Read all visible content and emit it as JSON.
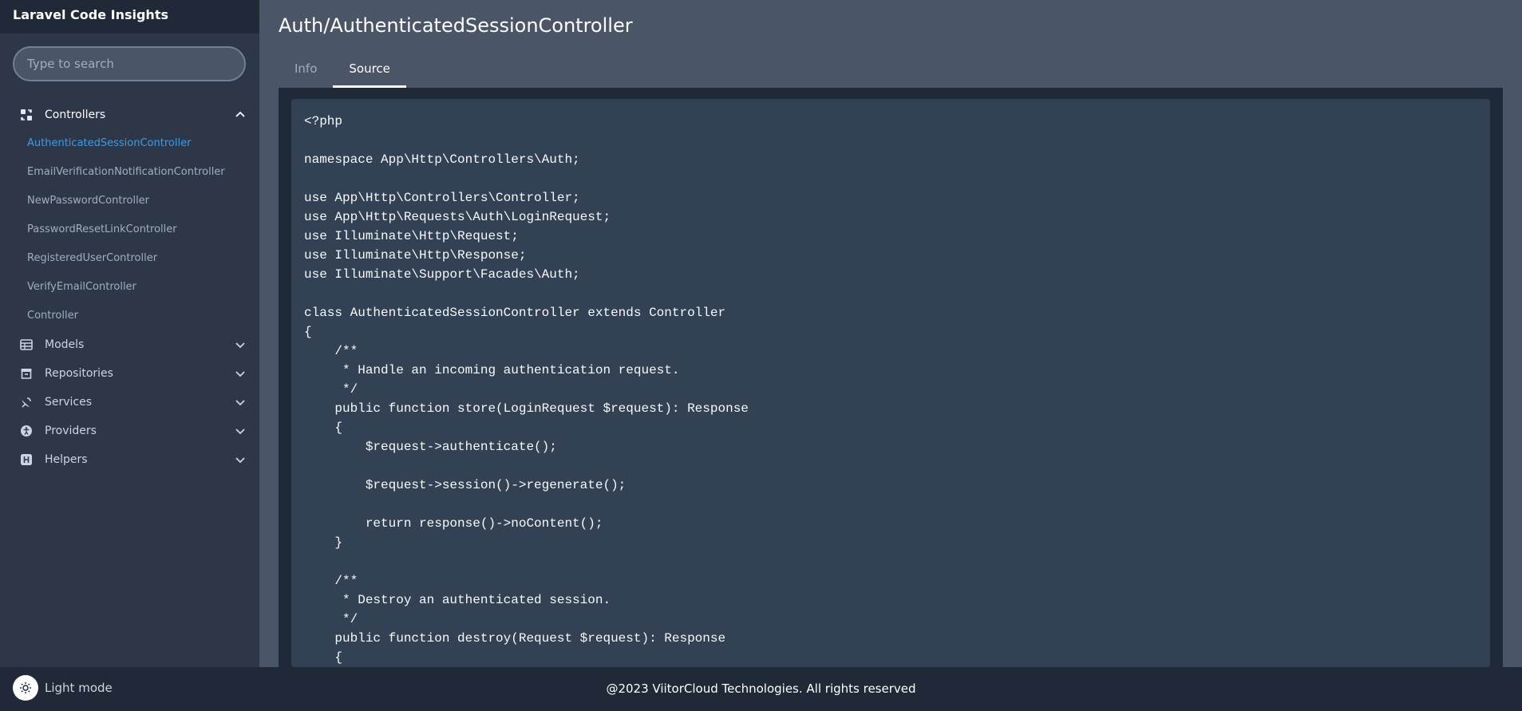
{
  "app": {
    "title": "Laravel Code Insights"
  },
  "search": {
    "placeholder": "Type to search"
  },
  "sidebar": {
    "groups": [
      {
        "label": "Controllers",
        "icon": "controllers-icon",
        "expanded": true,
        "items": [
          {
            "label": "AuthenticatedSessionController",
            "active": true
          },
          {
            "label": "EmailVerificationNotificationController"
          },
          {
            "label": "NewPasswordController"
          },
          {
            "label": "PasswordResetLinkController"
          },
          {
            "label": "RegisteredUserController"
          },
          {
            "label": "VerifyEmailController"
          },
          {
            "label": "Controller"
          }
        ]
      },
      {
        "label": "Models",
        "icon": "table-icon",
        "expanded": false
      },
      {
        "label": "Repositories",
        "icon": "archive-icon",
        "expanded": false
      },
      {
        "label": "Services",
        "icon": "satellite-dish-icon",
        "expanded": false
      },
      {
        "label": "Providers",
        "icon": "accessibility-icon",
        "expanded": false
      },
      {
        "label": "Helpers",
        "icon": "helper-h-icon",
        "expanded": false
      }
    ]
  },
  "main": {
    "title": "Auth/AuthenticatedSessionController",
    "tabs": [
      {
        "label": "Info",
        "active": false
      },
      {
        "label": "Source",
        "active": true
      }
    ],
    "source_code": "<?php\n\nnamespace App\\Http\\Controllers\\Auth;\n\nuse App\\Http\\Controllers\\Controller;\nuse App\\Http\\Requests\\Auth\\LoginRequest;\nuse Illuminate\\Http\\Request;\nuse Illuminate\\Http\\Response;\nuse Illuminate\\Support\\Facades\\Auth;\n\nclass AuthenticatedSessionController extends Controller\n{\n    /**\n     * Handle an incoming authentication request.\n     */\n    public function store(LoginRequest $request): Response\n    {\n        $request->authenticate();\n\n        $request->session()->regenerate();\n\n        return response()->noContent();\n    }\n\n    /**\n     * Destroy an authenticated session.\n     */\n    public function destroy(Request $request): Response\n    {"
  },
  "footer": {
    "mode_label": "Light mode",
    "copyright": "@2023 ViitorCloud Technologies. All rights reserved"
  },
  "colors": {
    "accent": "#4299e1",
    "sidebar_bg": "#2d3748",
    "main_bg": "#4a5568",
    "footer_bg": "#1f2937",
    "code_bg": "#334155"
  }
}
